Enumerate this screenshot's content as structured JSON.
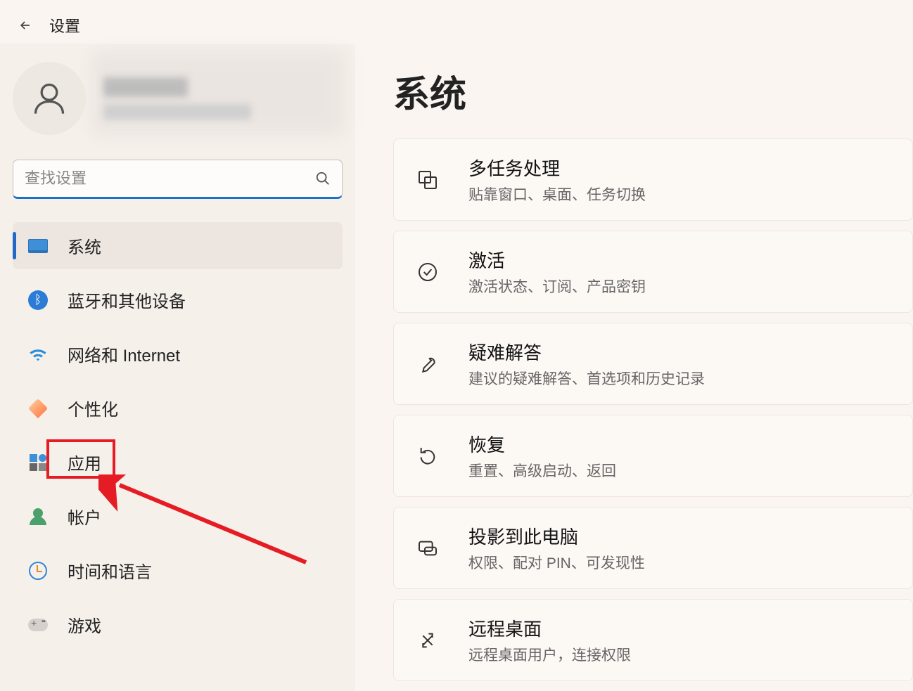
{
  "header": {
    "title": "设置"
  },
  "search": {
    "placeholder": "查找设置"
  },
  "nav": {
    "items": [
      {
        "label": "系统"
      },
      {
        "label": "蓝牙和其他设备"
      },
      {
        "label": "网络和 Internet"
      },
      {
        "label": "个性化"
      },
      {
        "label": "应用"
      },
      {
        "label": "帐户"
      },
      {
        "label": "时间和语言"
      },
      {
        "label": "游戏"
      }
    ]
  },
  "content": {
    "title": "系统",
    "cards": [
      {
        "title": "多任务处理",
        "desc": "贴靠窗口、桌面、任务切换"
      },
      {
        "title": "激活",
        "desc": "激活状态、订阅、产品密钥"
      },
      {
        "title": "疑难解答",
        "desc": "建议的疑难解答、首选项和历史记录"
      },
      {
        "title": "恢复",
        "desc": "重置、高级启动、返回"
      },
      {
        "title": "投影到此电脑",
        "desc": "权限、配对 PIN、可发现性"
      },
      {
        "title": "远程桌面",
        "desc": "远程桌面用户，连接权限"
      }
    ]
  }
}
